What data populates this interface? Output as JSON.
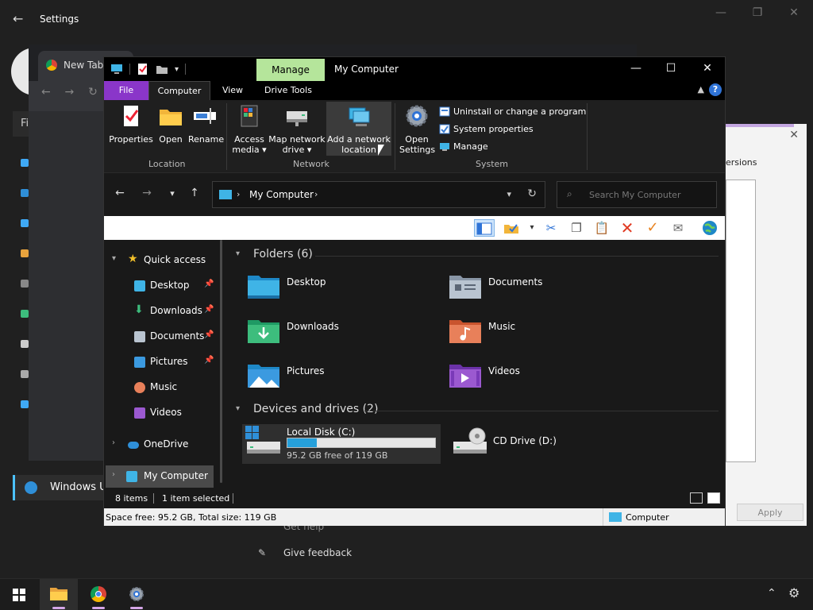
{
  "settings": {
    "title": "Settings",
    "back_glyph": "←",
    "search_partial": "Fi",
    "windows_update_label": "Windows U",
    "get_help": "Get help",
    "give_feedback": "Give feedback"
  },
  "chrome": {
    "tab_title": "New Tab"
  },
  "dialog": {
    "tab_partial": "ersions",
    "apply_label": "Apply"
  },
  "explorer": {
    "title": "My Computer",
    "context_tab": "Manage",
    "tabs": {
      "file": "File",
      "computer": "Computer",
      "view": "View",
      "drive_tools": "Drive Tools"
    },
    "ribbon": {
      "location": {
        "label": "Location",
        "properties": "Properties",
        "open": "Open",
        "rename": "Rename"
      },
      "network": {
        "label": "Network",
        "access_media_1": "Access",
        "access_media_2": "media ▾",
        "map_drive_1": "Map network",
        "map_drive_2": "drive ▾",
        "add_location_1": "Add a network",
        "add_location_2": "location"
      },
      "system": {
        "label": "System",
        "open_settings_1": "Open",
        "open_settings_2": "Settings",
        "uninstall": "Uninstall or change a program",
        "system_properties": "System properties",
        "manage": "Manage"
      }
    },
    "address": {
      "location": "My Computer"
    },
    "search": {
      "placeholder": "Search My Computer"
    },
    "nav": {
      "quick_access": "Quick access",
      "desktop": "Desktop",
      "downloads": "Downloads",
      "documents": "Documents",
      "pictures": "Pictures",
      "music": "Music",
      "videos": "Videos",
      "onedrive": "OneDrive",
      "my_computer": "My Computer"
    },
    "folders_header": "Folders (6)",
    "folders": {
      "desktop": "Desktop",
      "documents": "Documents",
      "downloads": "Downloads",
      "music": "Music",
      "pictures": "Pictures",
      "videos": "Videos"
    },
    "devices_header": "Devices and drives (2)",
    "drives": {
      "c": {
        "name": "Local Disk (C:)",
        "free_text": "95.2 GB free of 119 GB",
        "used_fraction": 0.2
      },
      "d": {
        "name": "CD Drive (D:)"
      }
    },
    "status": {
      "items": "8 items",
      "selected": "1 item selected"
    },
    "infobar": {
      "space": "Space free: 95.2 GB, Total size: 119 GB",
      "computer": "Computer"
    }
  },
  "colors": {
    "file_tab": "#8a36c9",
    "manage_tab": "#b5e59b",
    "accent": "#26a0da"
  }
}
